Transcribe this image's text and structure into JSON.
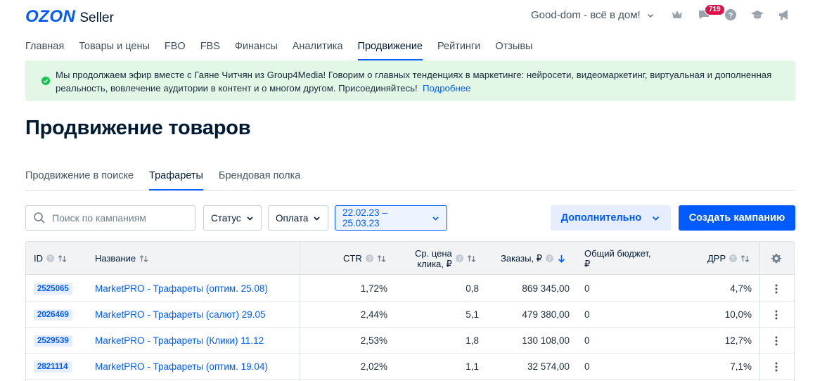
{
  "header": {
    "logo_brand": "OZON",
    "logo_product": "Seller",
    "store_name": "Good-dom - всё в дом!",
    "notifications_count": "719",
    "icons": [
      "crown-icon",
      "chat-icon",
      "help-icon",
      "graduation-cap-icon",
      "megaphone-icon"
    ]
  },
  "nav": {
    "items": [
      "Главная",
      "Товары и цены",
      "FBO",
      "FBS",
      "Финансы",
      "Аналитика",
      "Продвижение",
      "Рейтинги",
      "Отзывы"
    ],
    "active": "Продвижение"
  },
  "banner": {
    "text": "Мы продолжаем эфир вместе с Гаяне Читчян из Group4Media! Говорим о главных тенденциях в маркетинге: нейросети, видеомаркетинг, виртуальная и дополненная реальность, вовлечение аудитории в контент и о многом другом. Присоединяйтесь!",
    "link": "Подробнее"
  },
  "page": {
    "title": "Продвижение товаров"
  },
  "subtabs": {
    "items": [
      "Продвижение в поиске",
      "Трафареты",
      "Брендовая полка"
    ],
    "active": "Трафареты"
  },
  "filters": {
    "search_placeholder": "Поиск по кампаниям",
    "status_label": "Статус",
    "payment_label": "Оплата",
    "date_range": "22.02.23 – 25.03.23",
    "more_label": "Дополнительно",
    "create_label": "Создать кампанию"
  },
  "table": {
    "columns": {
      "id": "ID",
      "name": "Название",
      "ctr": "CTR",
      "cpc_line1": "Ср. цена",
      "cpc_line2": "клика, ₽",
      "orders": "Заказы, ₽",
      "budget_line1": "Общий бюджет,",
      "budget_line2": "₽",
      "drr": "ДРР"
    },
    "rows": [
      {
        "id": "2525065",
        "name": "MarketPRO - Трафареты (оптим. 25.08)",
        "ctr": "1,72%",
        "cpc": "0,8",
        "orders": "869 345,00",
        "budget": "0",
        "drr": "4,7%"
      },
      {
        "id": "2026469",
        "name": "MarketPRO - Трафареты (салют) 29.05",
        "ctr": "2,44%",
        "cpc": "5,1",
        "orders": "479 380,00",
        "budget": "0",
        "drr": "10,0%"
      },
      {
        "id": "2529539",
        "name": "MarketPRO - Трафареты (Клики) 11.12",
        "ctr": "2,53%",
        "cpc": "1,8",
        "orders": "130 108,00",
        "budget": "0",
        "drr": "12,7%"
      },
      {
        "id": "2821114",
        "name": "MarketPRO - Трафареты (оптим. 19.04)",
        "ctr": "2,02%",
        "cpc": "1,1",
        "orders": "32 574,00",
        "budget": "0",
        "drr": "7,1%"
      }
    ]
  },
  "colors": {
    "brand": "#005bff",
    "banner_bg": "#e2f7e6",
    "success": "#10c44c",
    "badge": "#e0124b"
  }
}
